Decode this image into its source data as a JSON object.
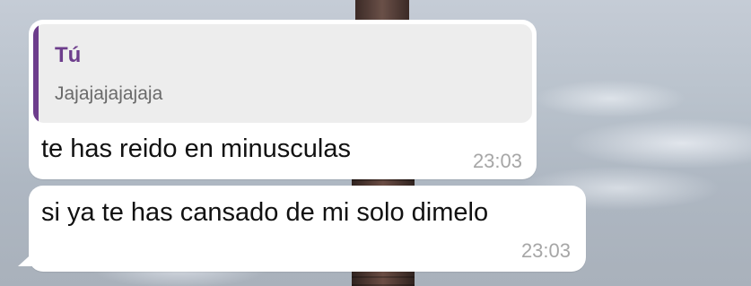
{
  "messages": [
    {
      "quoted": {
        "author": "Tú",
        "text": "Jajajajajajaja",
        "accent_color": "#6d3d8c"
      },
      "text": "te has reido en minusculas",
      "time": "23:03"
    },
    {
      "text": "si ya te has cansado de mi solo dimelo",
      "time": "23:03"
    }
  ],
  "colors": {
    "bubble": "#ffffff",
    "quote_background": "#ededed",
    "timestamp": "#a6a6a6"
  }
}
